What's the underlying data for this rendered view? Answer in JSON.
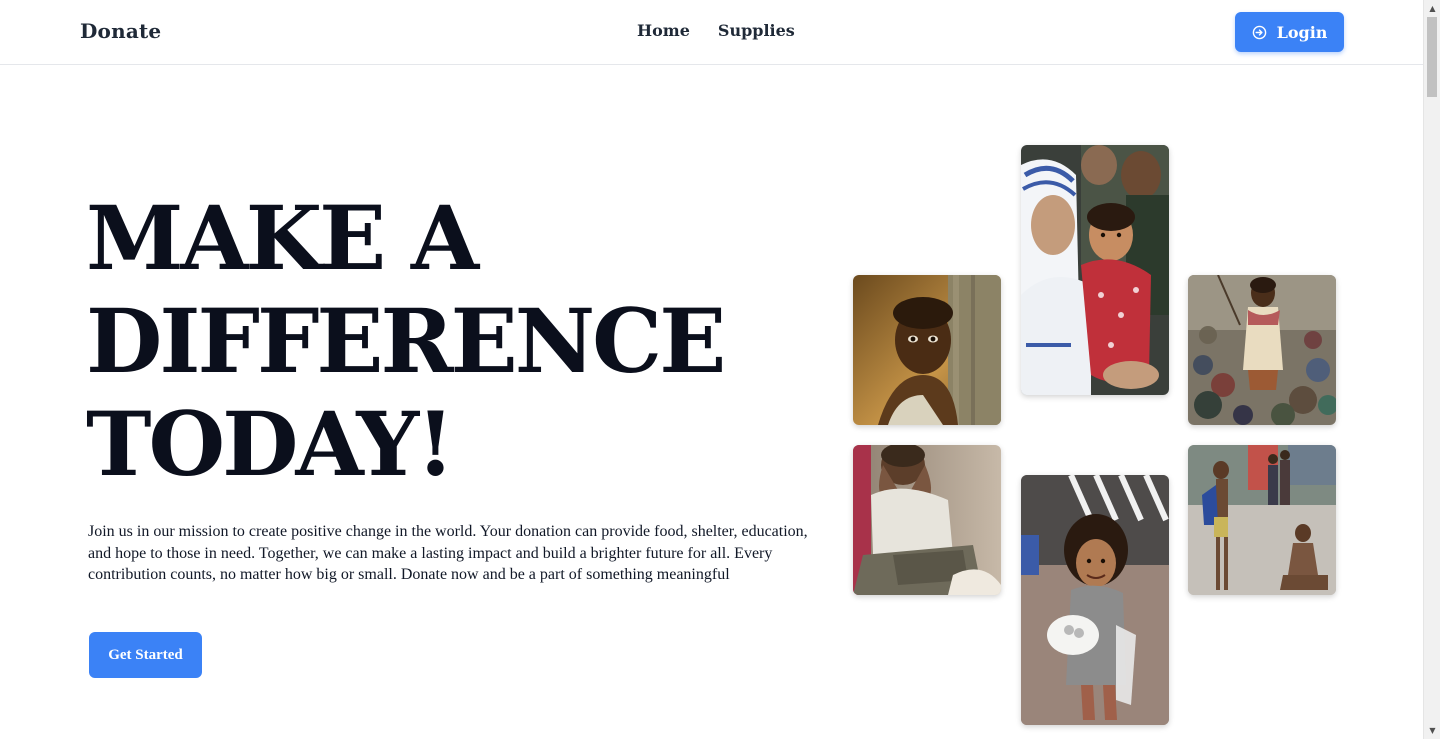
{
  "nav": {
    "brand": "Donate",
    "links": [
      "Home",
      "Supplies"
    ],
    "login_label": "Login",
    "login_icon": "login-arrow-icon"
  },
  "hero": {
    "title_lines": [
      "MAKE A",
      "DIFFERENCE",
      "TODAY!"
    ],
    "description": "Join us in our mission to create positive change in the world. Your donation can provide food, shelter, education, and hope to those in need. Together, we can make a lasting impact and build a brighter future for all. Every contribution counts, no matter how big or small. Donate now and be a part of something meaningful",
    "cta_label": "Get Started"
  },
  "gallery": {
    "photos": [
      "child-behind-post-photo",
      "nun-holding-child-photo",
      "girl-on-garbage-dump-photo",
      "man-sitting-head-in-hands-photo",
      "girl-holding-bowl-photo",
      "children-on-street-photo"
    ]
  },
  "colors": {
    "accent": "#3b82f6",
    "heading": "#0b0f1c",
    "text": "#111827",
    "border": "#e5e7eb"
  }
}
